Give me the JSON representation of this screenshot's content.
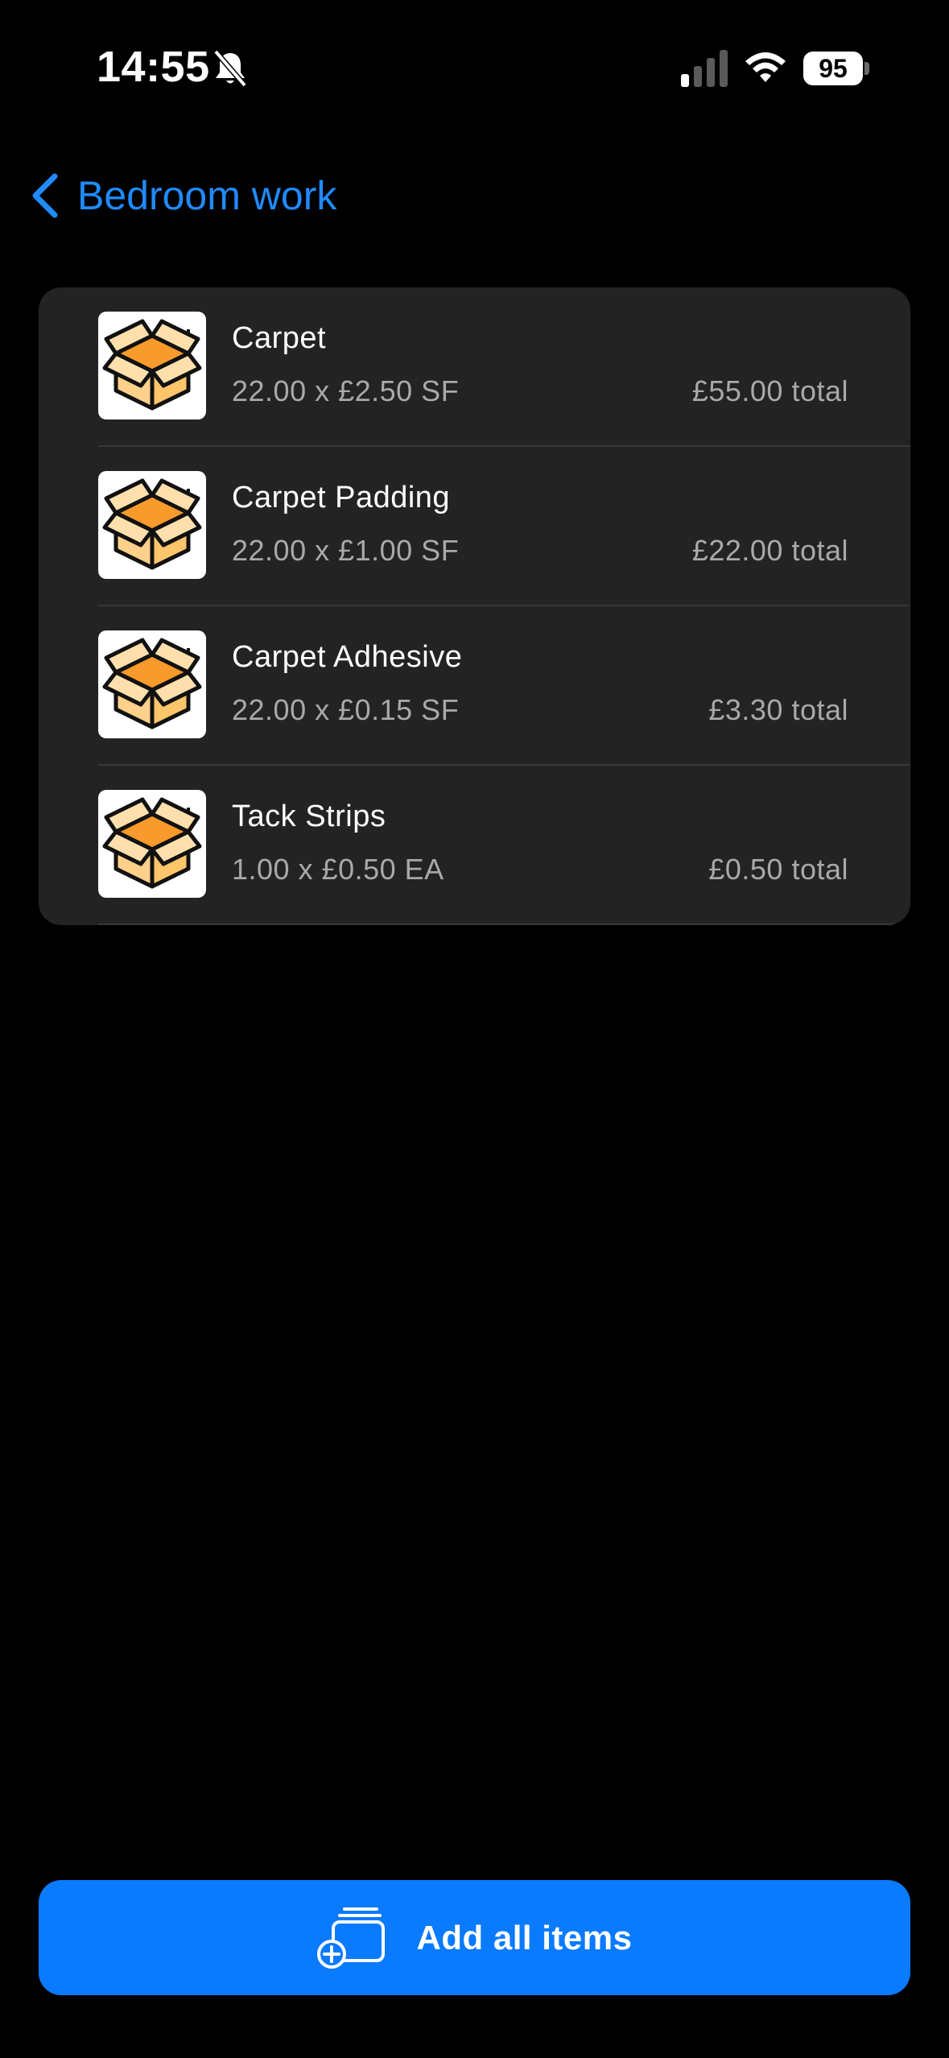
{
  "status_bar": {
    "time": "14:55",
    "battery": "95",
    "icons": [
      "bell-slash-icon",
      "cellular-signal-icon",
      "wifi-icon",
      "battery-icon"
    ]
  },
  "nav": {
    "back_label": "Bedroom work",
    "accent_color": "#1f8bff"
  },
  "items": [
    {
      "name": "Carpet",
      "qty_line": "22.00 x £2.50 SF",
      "total": "£55.00 total",
      "icon": "box-icon"
    },
    {
      "name": "Carpet Padding",
      "qty_line": "22.00 x £1.00 SF",
      "total": "£22.00 total",
      "icon": "box-icon"
    },
    {
      "name": "Carpet Adhesive",
      "qty_line": "22.00 x £0.15 SF",
      "total": "£3.30 total",
      "icon": "box-icon"
    },
    {
      "name": "Tack Strips",
      "qty_line": "1.00 x £0.50 EA",
      "total": "£0.50 total",
      "icon": "box-icon"
    }
  ],
  "add_button": {
    "label": "Add all items",
    "icon": "add-stack-icon",
    "color": "#0a7aff"
  }
}
